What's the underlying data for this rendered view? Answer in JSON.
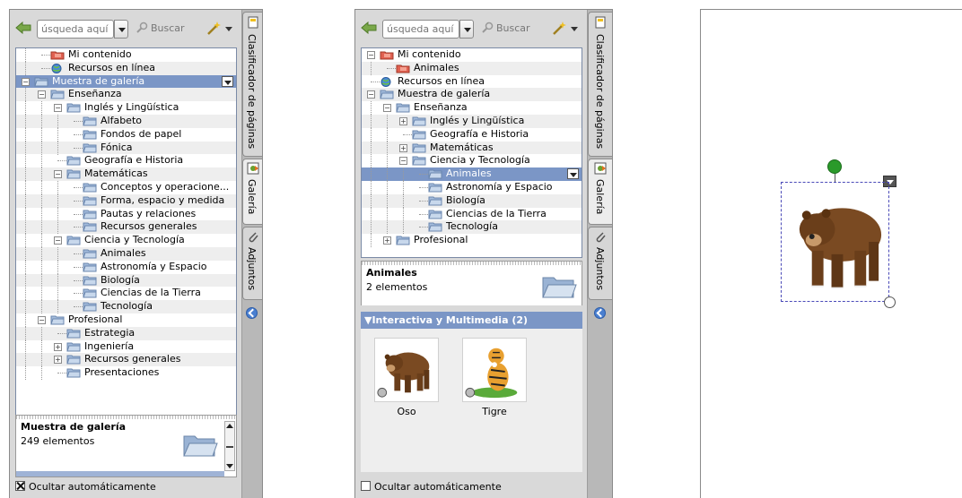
{
  "colors": {
    "selection": "#7b96c6",
    "panel": "#d9d9d9",
    "rail": "#b8b8b8"
  },
  "panel1": {
    "toolbar": {
      "search_placeholder": "úsqueda aquí",
      "search_button": "Buscar"
    },
    "tree": [
      {
        "label": "Mi contenido"
      },
      {
        "label": "Recursos en línea"
      },
      {
        "label": "Muestra de galería"
      },
      {
        "label": "Enseñanza"
      },
      {
        "label": "Inglés y Lingüística"
      },
      {
        "label": "Alfabeto"
      },
      {
        "label": "Fondos de papel"
      },
      {
        "label": "Fónica"
      },
      {
        "label": "Geografía e Historia"
      },
      {
        "label": "Matemáticas"
      },
      {
        "label": "Conceptos y operacione..."
      },
      {
        "label": "Forma, espacio y medida"
      },
      {
        "label": "Pautas y relaciones"
      },
      {
        "label": "Recursos generales"
      },
      {
        "label": "Ciencia y Tecnología"
      },
      {
        "label": "Animales"
      },
      {
        "label": "Astronomía y Espacio"
      },
      {
        "label": "Biología"
      },
      {
        "label": "Ciencias de la Tierra"
      },
      {
        "label": "Tecnología"
      },
      {
        "label": "Profesional"
      },
      {
        "label": "Estrategia"
      },
      {
        "label": "Ingeniería"
      },
      {
        "label": "Recursos generales"
      },
      {
        "label": "Presentaciones"
      }
    ],
    "info": {
      "title": "Muestra de galería",
      "count": "249 elementos"
    },
    "autohide": "Ocultar automáticamente",
    "tabs": {
      "pages": "Clasificador de páginas",
      "gallery": "Galería",
      "attachments": "Adjuntos"
    }
  },
  "panel2": {
    "toolbar": {
      "search_placeholder": "úsqueda aquí",
      "search_button": "Buscar"
    },
    "tree": [
      {
        "label": "Mi contenido"
      },
      {
        "label": "Animales"
      },
      {
        "label": "Recursos en línea"
      },
      {
        "label": "Muestra de galería"
      },
      {
        "label": "Enseñanza"
      },
      {
        "label": "Inglés y Lingüística"
      },
      {
        "label": "Geografía e Historia"
      },
      {
        "label": "Matemáticas"
      },
      {
        "label": "Ciencia y Tecnología"
      },
      {
        "label": "Animales"
      },
      {
        "label": "Astronomía y Espacio"
      },
      {
        "label": "Biología"
      },
      {
        "label": "Ciencias de la Tierra"
      },
      {
        "label": "Tecnología"
      },
      {
        "label": "Profesional"
      }
    ],
    "info": {
      "title": "Animales",
      "count": "2 elementos"
    },
    "section": "▼Interactiva y Multimedia (2)",
    "items": [
      {
        "label": "Oso"
      },
      {
        "label": "Tigre"
      }
    ],
    "autohide": "Ocultar automáticamente",
    "tabs": {
      "pages": "Clasificador de páginas",
      "gallery": "Galería",
      "attachments": "Adjuntos"
    }
  }
}
